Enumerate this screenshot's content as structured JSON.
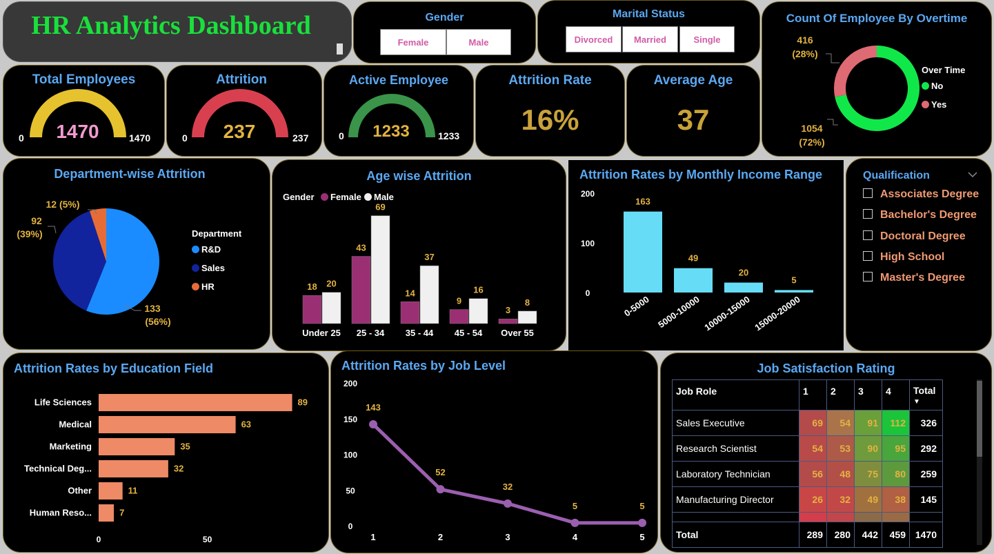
{
  "header": {
    "title": "HR Analytics Dashboard"
  },
  "gender_slicer": {
    "title": "Gender",
    "options": [
      "Female",
      "Male"
    ]
  },
  "marital_slicer": {
    "title": "Marital Status",
    "options": [
      "Divorced",
      "Married",
      "Single"
    ]
  },
  "kpis": {
    "total_employees": {
      "title": "Total Employees",
      "value": "1470",
      "min": "0",
      "max": "1470",
      "color": "#e6c22e",
      "value_color": "#f39ad0",
      "fraction": 1.0
    },
    "attrition": {
      "title": "Attrition",
      "value": "237",
      "min": "0",
      "max": "237",
      "color": "#d9404f",
      "value_color": "#e3b341",
      "fraction": 1.0
    },
    "active_employee": {
      "title": "Active Employee",
      "value": "1233",
      "min": "0",
      "max": "1233",
      "color": "#3a944a",
      "value_color": "#e3b341",
      "fraction": 1.0
    },
    "attrition_rate": {
      "title": "Attrition Rate",
      "value": "16%"
    },
    "average_age": {
      "title": "Average Age",
      "value": "37"
    }
  },
  "colors": {
    "kpi_value": "#c9a23a",
    "title_blue": "#5ba8f2",
    "label_yellow": "#e3b341",
    "female": "#9b2f74",
    "male": "#f0f0f0",
    "income_bar": "#66dcf6",
    "education_bar": "#ee8a65",
    "job_level_line": "#9b5fb0",
    "dept_rd": "#1a8cff",
    "dept_sales": "#12239e",
    "dept_hr": "#e66c37",
    "overtime_no": "#10e84a",
    "overtime_yes": "#de6a73"
  },
  "qualification": {
    "title": "Qualification",
    "chevron_icon": "chevron-down-icon",
    "items": [
      "Associates Degree",
      "Bachelor's Degree",
      "Doctoral Degree",
      "High School",
      "Master's Degree"
    ]
  },
  "chart_data": [
    {
      "type": "pie",
      "id": "overtime",
      "title": "Count Of Employee By Overtime",
      "legend_title": "Over Time",
      "categories": [
        "No",
        "Yes"
      ],
      "values": [
        1054,
        416
      ],
      "labels": [
        [
          "1054",
          "(72%)"
        ],
        [
          "416",
          "(28%)"
        ]
      ],
      "donut": true
    },
    {
      "type": "pie",
      "id": "department",
      "title": "Department-wise Attrition",
      "legend_title": "Department",
      "categories": [
        "R&D",
        "Sales",
        "HR"
      ],
      "values": [
        133,
        92,
        12
      ],
      "labels": [
        [
          "133",
          "(56%)"
        ],
        [
          "92",
          "(39%)"
        ],
        [
          "12 (5%)"
        ]
      ]
    },
    {
      "type": "bar",
      "id": "age",
      "title": "Age wise Attrition",
      "legend_title": "Gender",
      "categories": [
        "Under 25",
        "25 - 34",
        "35 - 44",
        "45 - 54",
        "Over 55"
      ],
      "series": [
        {
          "name": "Female",
          "values": [
            18,
            43,
            14,
            9,
            3
          ]
        },
        {
          "name": "Male",
          "values": [
            20,
            69,
            37,
            16,
            8
          ]
        }
      ],
      "ylim": [
        0,
        75
      ]
    },
    {
      "type": "bar",
      "id": "income",
      "title": "Attrition Rates by Monthly Income Range",
      "categories": [
        "0-5000",
        "5000-10000",
        "10000-15000",
        "15000-20000"
      ],
      "values": [
        163,
        49,
        20,
        5
      ],
      "yticks": [
        "0",
        "100",
        "200"
      ],
      "ylim": [
        0,
        200
      ]
    },
    {
      "type": "bar",
      "id": "education",
      "title": "Attrition Rates by Education Field",
      "orientation": "horizontal",
      "categories": [
        "Life Sciences",
        "Medical",
        "Marketing",
        "Technical Deg...",
        "Other",
        "Human Reso..."
      ],
      "values": [
        89,
        63,
        35,
        32,
        11,
        7
      ],
      "xticks": [
        "0",
        "50"
      ],
      "xlim": [
        0,
        92
      ]
    },
    {
      "type": "line",
      "id": "joblevel",
      "title": "Attrition Rates by Job Level",
      "x": [
        "1",
        "2",
        "3",
        "4",
        "5"
      ],
      "values": [
        143,
        52,
        32,
        5,
        5
      ],
      "yticks": [
        "0",
        "50",
        "100",
        "150",
        "200"
      ],
      "ylim": [
        0,
        200
      ]
    },
    {
      "type": "table",
      "id": "jobsat",
      "title": "Job Satisfaction Rating",
      "columns": [
        "Job Role",
        "1",
        "2",
        "3",
        "4",
        "Total"
      ],
      "rows": [
        {
          "role": "Sales Executive",
          "values": [
            "69",
            "54",
            "91",
            "112"
          ],
          "total": "326",
          "colors": [
            "#b44b4b",
            "#a9744a",
            "#6a9f3a",
            "#1cc43a"
          ]
        },
        {
          "role": "Research Scientist",
          "values": [
            "54",
            "53",
            "90",
            "95"
          ],
          "total": "292",
          "colors": [
            "#b84a4a",
            "#ad5a48",
            "#6e9b3c",
            "#48a63c"
          ]
        },
        {
          "role": "Laboratory Technician",
          "values": [
            "56",
            "48",
            "75",
            "80"
          ],
          "total": "259",
          "colors": [
            "#b34b4b",
            "#b25048",
            "#7e8e3e",
            "#5d9a3e"
          ]
        },
        {
          "role": "Manufacturing Director",
          "values": [
            "26",
            "32",
            "49",
            "38"
          ],
          "total": "145",
          "colors": [
            "#c94646",
            "#c24848",
            "#a0703f",
            "#b06043"
          ]
        }
      ],
      "totals": {
        "label": "Total",
        "values": [
          "289",
          "280",
          "442",
          "459"
        ],
        "grand": "1470"
      }
    }
  ]
}
